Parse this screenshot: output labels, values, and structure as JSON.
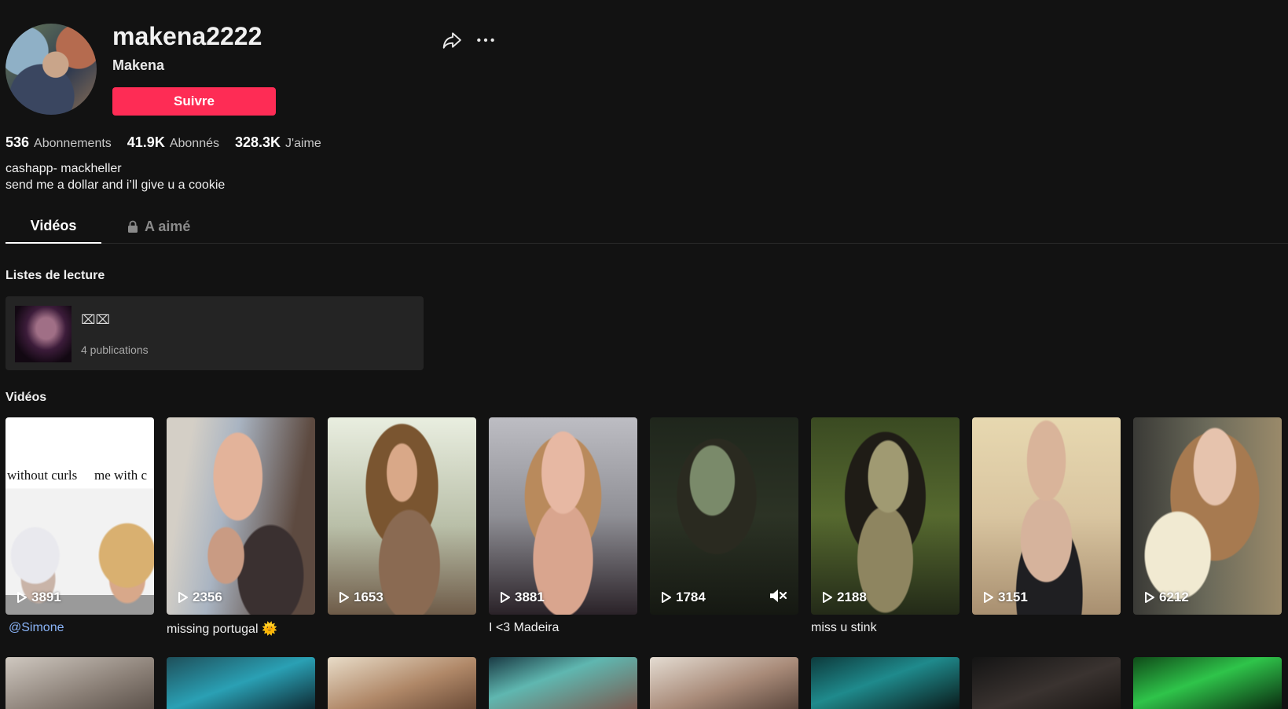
{
  "profile": {
    "username": "makena2222",
    "nickname": "Makena",
    "follow_label": "Suivre",
    "stats": [
      {
        "value": "536",
        "label": "Abonnements"
      },
      {
        "value": "41.9K",
        "label": "Abonnés"
      },
      {
        "value": "328.3K",
        "label": "J'aime"
      }
    ],
    "bio_lines": [
      "cashapp- mackheller",
      "send me a dollar and i’ll give u a cookie"
    ]
  },
  "icons": {
    "share": "share-icon",
    "more": "more-icon",
    "lock": "lock-icon",
    "play": "play-icon",
    "mute": "mute-icon"
  },
  "tabs": [
    {
      "label": "Vidéos",
      "active": true
    },
    {
      "label": "A aimé",
      "active": false,
      "locked": true
    }
  ],
  "playlists_section": {
    "title": "Listes de lecture",
    "items": [
      {
        "title": "⌧⌧",
        "count": "4 publications"
      }
    ]
  },
  "videos_section": {
    "title": "Vidéos",
    "videos": [
      {
        "views": "3891",
        "caption": "@Simone",
        "muted": false,
        "overlay_left": "without curls",
        "overlay_right": "me with c"
      },
      {
        "views": "2356",
        "caption": "missing portugal 🌞",
        "muted": false
      },
      {
        "views": "1653",
        "caption": "",
        "muted": false
      },
      {
        "views": "3881",
        "caption": "I <3 Madeira",
        "muted": false
      },
      {
        "views": "1784",
        "caption": "",
        "muted": true
      },
      {
        "views": "2188",
        "caption": "miss u stink",
        "muted": false
      },
      {
        "views": "3151",
        "caption": "",
        "muted": false
      },
      {
        "views": "6212",
        "caption": "",
        "muted": false
      }
    ]
  },
  "colors": {
    "background": "#121212",
    "accent": "#fe2c55",
    "mention": "#8ab4f8"
  }
}
